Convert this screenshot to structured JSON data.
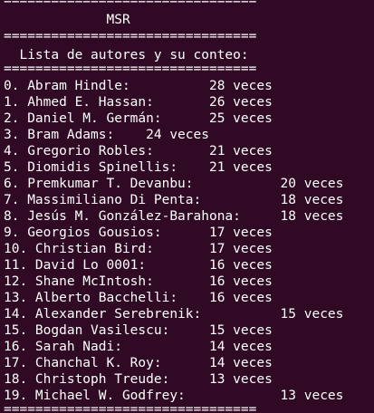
{
  "terminal": {
    "lines": [
      "================================",
      "             MSR",
      "================================",
      "  Lista de autores y su conteo:",
      "================================",
      "0. Abram Hindle:          28 veces",
      "1. Ahmed E. Hassan:       26 veces",
      "2. Daniel M. Germán:      25 veces",
      "3. Bram Adams:    24 veces",
      "4. Gregorio Robles:       21 veces",
      "5. Diomidis Spinellis:    21 veces",
      "6. Premkumar T. Devanbu:           20 veces",
      "7. Massimiliano Di Penta:          18 veces",
      "8. Jesús M. González-Barahona:     18 veces",
      "9. Georgios Gousios:      17 veces",
      "10. Christian Bird:       17 veces",
      "11. David Lo 0001:        16 veces",
      "12. Shane McIntosh:       16 veces",
      "13. Alberto Bacchelli:    16 veces",
      "14. Alexander Serebrenik:          15 veces",
      "15. Bogdan Vasilescu:     15 veces",
      "16. Sarah Nadi:           14 veces",
      "17. Chanchal K. Roy:      14 veces",
      "18. Christoph Treude:     13 veces",
      "19. Michael W. Godfrey:            13 veces",
      "================================"
    ]
  }
}
